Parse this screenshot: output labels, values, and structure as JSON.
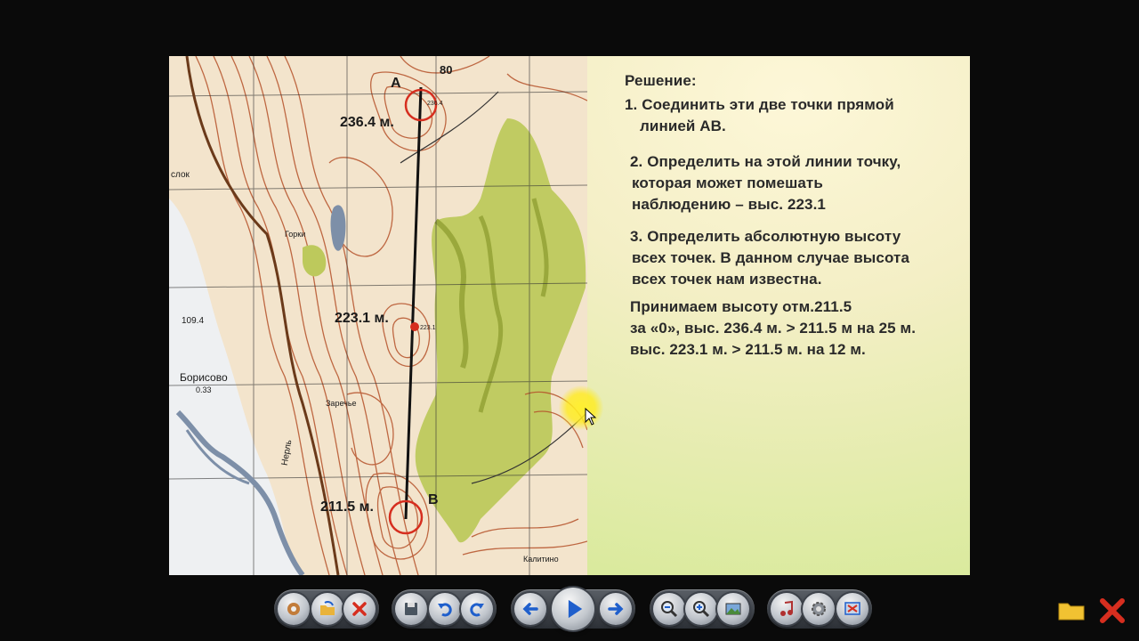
{
  "slide": {
    "solution_title": "Решение:",
    "steps": [
      [
        "1. Соединить эти две точки прямой",
        "линией АВ."
      ],
      [
        "2. Определить на этой линии точку,",
        "которая может помешать",
        "наблюдению – выс. 223.1"
      ],
      [
        "3. Определить абсолютную высоту",
        "всех точек. В данном случае высота",
        "всех точек нам известна."
      ],
      [
        "Принимаем высоту отм.211.5",
        "за «0», выс. 236.4 м. > 211.5 м на 25 м.",
        "выс. 223.1 м. > 211.5 м. на 12 м."
      ]
    ]
  },
  "map": {
    "point_a_letter": "А",
    "point_b_letter": "В",
    "label_a": "236.4 м.",
    "label_mid": "223.1 м.",
    "label_b": "211.5 м.",
    "grid_number": "80",
    "village_borisovo": "Борисово",
    "borisovo_pop": "0.33",
    "village_gorki": "Горки",
    "village_zarechye": "Заречье",
    "village_kalitino": "Калитино",
    "river_name": "Нерль",
    "side_label": "слок",
    "elev_left": "109.4",
    "elev_a_small": "236.4",
    "elev_mid_small": "223.1"
  },
  "toolbar": {
    "icons": [
      "settings-icon",
      "open-folder-icon",
      "close-x-icon",
      "save-icon",
      "undo-icon",
      "redo-icon",
      "prev-arrow-icon",
      "play-icon",
      "next-arrow-icon",
      "zoom-out-icon",
      "zoom-in-icon",
      "picture-icon",
      "music-icon",
      "options-gear-icon",
      "fullscreen-icon"
    ],
    "folder_icon": "folder-icon",
    "close_icon": "exit-x-icon"
  },
  "colors": {
    "contour": "#b5522a",
    "forest": "#b9c95a",
    "target_circle": "#d62e1f",
    "accent_blue": "#1f5fcc"
  }
}
